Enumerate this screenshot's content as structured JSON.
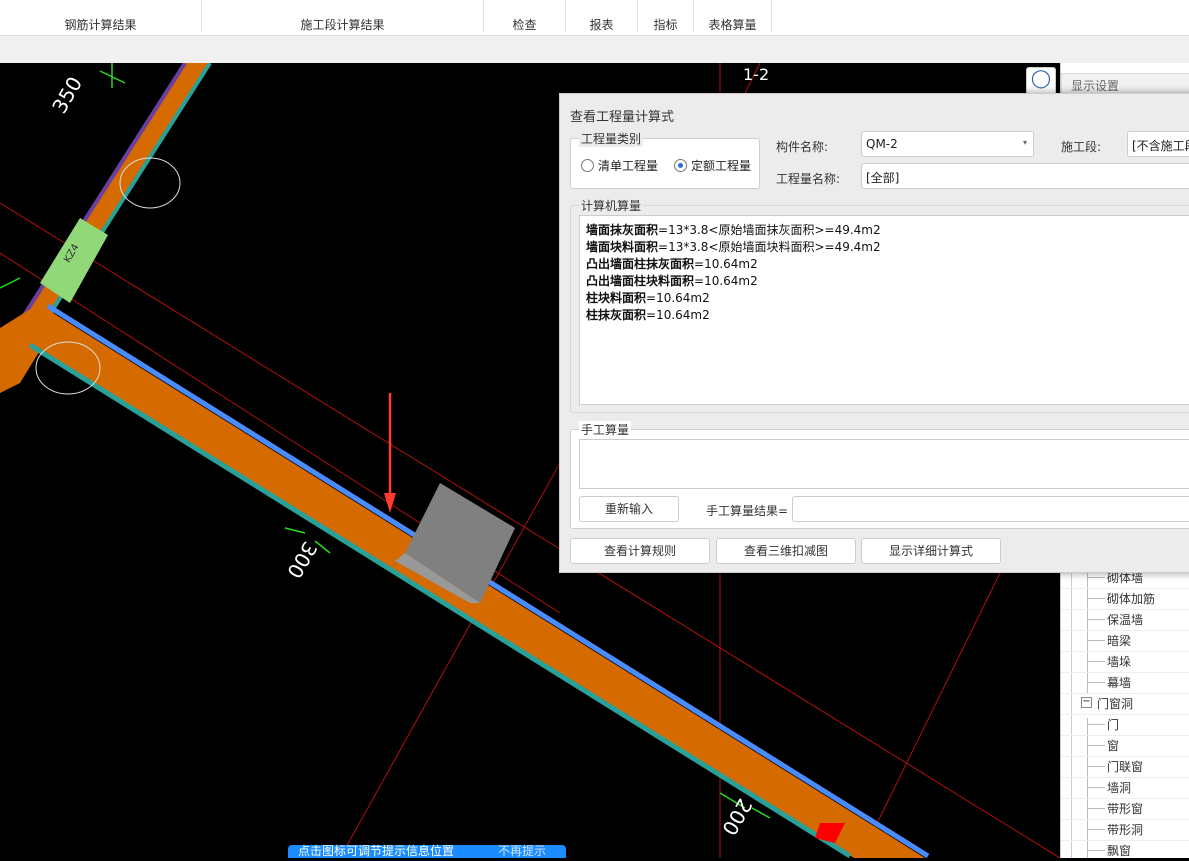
{
  "ribbon": {
    "groups": [
      "钢筋计算结果",
      "施工段计算结果",
      "检查",
      "报表",
      "指标",
      "表格算量"
    ]
  },
  "canvas": {
    "axis_label": "1-2",
    "dimensions": [
      "350",
      "300",
      "200"
    ],
    "column_label": "KZ4",
    "colors": {
      "wall": "#d46a00",
      "wall_edge": "#2aa198",
      "column": "#90d878",
      "highlight": "#ff0000",
      "grid_line": "#b01010",
      "arrow": "#ff3b30"
    }
  },
  "dialog": {
    "title": "查看工程量计算式",
    "category_legend": "工程量类别",
    "radio_bill": "清单工程量",
    "radio_quota": "定额工程量",
    "selected_category": "定额工程量",
    "component_label": "构件名称:",
    "component_value": "QM-2",
    "stage_label": "施工段:",
    "stage_value": "[不含施工段",
    "quantity_name_label": "工程量名称:",
    "quantity_name_value": "[全部]",
    "computer_legend": "计算机算量",
    "formulas": [
      {
        "name": "墙面抹灰面积",
        "expr": "=13*3.8<原始墙面抹灰面积>=49.4m2"
      },
      {
        "name": "墙面块料面积",
        "expr": "=13*3.8<原始墙面块料面积>=49.4m2"
      },
      {
        "name": "凸出墙面柱抹灰面积",
        "expr": "=10.64m2"
      },
      {
        "name": "凸出墙面柱块料面积",
        "expr": "=10.64m2"
      },
      {
        "name": "柱块料面积",
        "expr": "=10.64m2"
      },
      {
        "name": "柱抹灰面积",
        "expr": "=10.64m2"
      }
    ],
    "manual_legend": "手工算量",
    "reinput_button": "重新输入",
    "manual_result_label": "手工算量结果=",
    "manual_result_value": "",
    "view_rules_button": "查看计算规则",
    "view_3d_button": "查看三维扣减图",
    "show_detail_button": "显示详细计算式"
  },
  "right_panel": {
    "title": "显示设置",
    "tree": [
      {
        "label": "砌体墙",
        "level": 2
      },
      {
        "label": "砌体加筋",
        "level": 2
      },
      {
        "label": "保温墙",
        "level": 2
      },
      {
        "label": "暗梁",
        "level": 2
      },
      {
        "label": "墙垛",
        "level": 2
      },
      {
        "label": "幕墙",
        "level": 2
      },
      {
        "label": "门窗洞",
        "level": 1,
        "expanded": true
      },
      {
        "label": "门",
        "level": 2
      },
      {
        "label": "窗",
        "level": 2
      },
      {
        "label": "门联窗",
        "level": 2
      },
      {
        "label": "墙洞",
        "level": 2
      },
      {
        "label": "带形窗",
        "level": 2
      },
      {
        "label": "带形洞",
        "level": 2
      },
      {
        "label": "飘窗",
        "level": 2
      }
    ]
  },
  "toast": {
    "message": "点击图标可调节提示信息位置",
    "dismiss": "不再提示"
  }
}
